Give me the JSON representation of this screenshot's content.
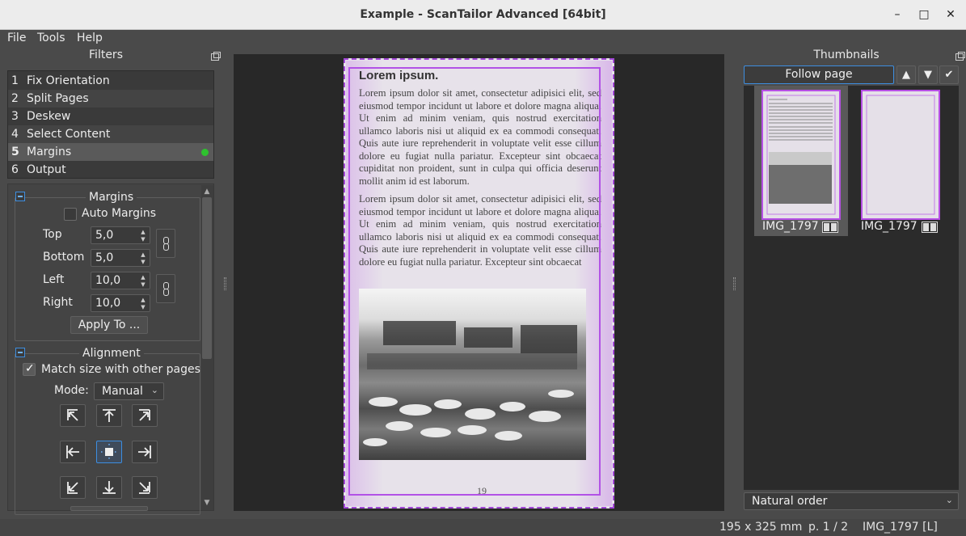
{
  "window": {
    "title": "Example - ScanTailor Advanced [64bit]",
    "minimize": "–",
    "maximize": "□",
    "close": "✕"
  },
  "menu": [
    "File",
    "Tools",
    "Help"
  ],
  "filters_panel": {
    "title": "Filters",
    "items": [
      {
        "num": "1",
        "label": "Fix Orientation"
      },
      {
        "num": "2",
        "label": "Split Pages"
      },
      {
        "num": "3",
        "label": "Deskew"
      },
      {
        "num": "4",
        "label": "Select Content"
      },
      {
        "num": "5",
        "label": "Margins"
      },
      {
        "num": "6",
        "label": "Output"
      }
    ],
    "selected_index": 4
  },
  "margins": {
    "title": "Margins",
    "auto_margins_label": "Auto Margins",
    "auto_margins_checked": false,
    "top_label": "Top",
    "top_value": "5,0",
    "bottom_label": "Bottom",
    "bottom_value": "5,0",
    "left_label": "Left",
    "left_value": "10,0",
    "right_label": "Right",
    "right_value": "10,0",
    "apply_button": "Apply To ..."
  },
  "alignment": {
    "title": "Alignment",
    "match_size_label": "Match size with other pages",
    "match_size_checked": true,
    "mode_label": "Mode:",
    "mode_value": "Manual",
    "selected": "center"
  },
  "document": {
    "heading": "Lorem ipsum.",
    "paragraph1": "Lorem ipsum dolor sit amet, consectetur adipisici elit, sed eiusmod tempor incidunt ut labore et dolore magna aliqua. Ut enim ad minim veniam, quis nostrud exercitation ullamco laboris nisi ut aliquid ex ea commodi consequat. Quis aute iure reprehenderit in voluptate velit esse cillum dolore eu fugiat nulla pariatur. Excepteur sint obcaecat cupiditat non proident, sunt in culpa qui officia deserunt mollit anim id est laborum.",
    "paragraph2": "Lorem ipsum dolor sit amet, consectetur adipisici elit, sed eiusmod tempor incidunt ut labore et dolore magna aliqua. Ut enim ad minim veniam, quis nostrud exercitation ullamco laboris nisi ut aliquid ex ea commodi consequat. Quis aute iure reprehenderit in voluptate velit esse cillum dolore eu fugiat nulla pariatur. Excepteur sint obcaecat",
    "page_number": "19"
  },
  "thumbnails_panel": {
    "title": "Thumbnails",
    "follow_page": "Follow page",
    "up_icon": "▲",
    "down_icon": "▼",
    "check_icon": "✔",
    "items": [
      {
        "label": "IMG_1797"
      },
      {
        "label": "IMG_1797"
      }
    ],
    "order_value": "Natural order"
  },
  "status": {
    "size": "195 x 325 mm",
    "page": "p. 1 / 2",
    "file": "IMG_1797 [L]"
  },
  "colors": {
    "accent": "#3d8ee0",
    "selection_border": "#b252e6",
    "status_green": "#2ec22e"
  }
}
